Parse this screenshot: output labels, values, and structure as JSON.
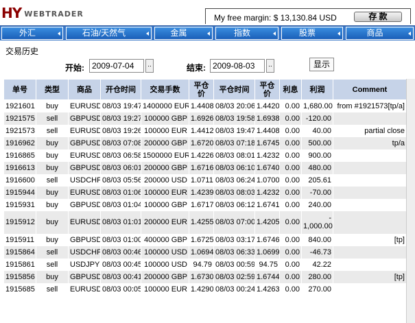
{
  "app": {
    "logo_hy": "HY",
    "logo_sub": "WEBTRADER",
    "margin_label": "My free margin: $ 13,130.84 USD",
    "deposit_label": "存 款"
  },
  "nav": [
    {
      "label": "外汇"
    },
    {
      "label": "石油/天然气"
    },
    {
      "label": "金属"
    },
    {
      "label": "指数"
    },
    {
      "label": "股票"
    },
    {
      "label": "商品"
    }
  ],
  "history": {
    "title": "交易历史",
    "start_label": "开始:",
    "start_value": "2009-07-04",
    "end_label": "结束:",
    "end_value": "2009-08-03",
    "date_btn": "..",
    "show_label": "显示"
  },
  "table": {
    "headers": [
      "单号",
      "类型",
      "商品",
      "开仓时间",
      "交易手数",
      "平仓\n价",
      "平仓时间",
      "平仓\n价",
      "利息",
      "利润",
      "Comment"
    ],
    "rows": [
      [
        "1921601",
        "buy",
        "EURUSD",
        "08/03 19:47",
        "1400000 EUR",
        "1.4408",
        "08/03 20:06",
        "1.4420",
        "0.00",
        "1,680.00",
        "from #1921573[tp/a]"
      ],
      [
        "1921575",
        "sell",
        "GBPUSD",
        "08/03 19:27",
        "100000 GBP",
        "1.6926",
        "08/03 19:58",
        "1.6938",
        "0.00",
        "-120.00",
        ""
      ],
      [
        "1921573",
        "sell",
        "EURUSD",
        "08/03 19:26",
        "100000 EUR",
        "1.4412",
        "08/03 19:47",
        "1.4408",
        "0.00",
        "40.00",
        "partial close"
      ],
      [
        "1916962",
        "buy",
        "GBPUSD",
        "08/03 07:08",
        "200000 GBP",
        "1.6720",
        "08/03 07:18",
        "1.6745",
        "0.00",
        "500.00",
        "tp/a"
      ],
      [
        "1916865",
        "buy",
        "EURUSD",
        "08/03 06:58",
        "1500000 EUR",
        "1.4226",
        "08/03 08:01",
        "1.4232",
        "0.00",
        "900.00",
        ""
      ],
      [
        "1916613",
        "buy",
        "GBPUSD",
        "08/03 06:01",
        "200000 GBP",
        "1.6716",
        "08/03 06:10",
        "1.6740",
        "0.00",
        "480.00",
        ""
      ],
      [
        "1916600",
        "sell",
        "USDCHF",
        "08/03 05:56",
        "200000 USD",
        "1.0711",
        "08/03 06:24",
        "1.0700",
        "0.00",
        "205.61",
        ""
      ],
      [
        "1915944",
        "buy",
        "EURUSD",
        "08/03 01:06",
        "100000 EUR",
        "1.4239",
        "08/03 08:03",
        "1.4232",
        "0.00",
        "-70.00",
        ""
      ],
      [
        "1915931",
        "buy",
        "GBPUSD",
        "08/03 01:04",
        "100000 GBP",
        "1.6717",
        "08/03 06:12",
        "1.6741",
        "0.00",
        "240.00",
        ""
      ],
      [
        "1915912",
        "buy",
        "EURUSD",
        "08/03 01:01",
        "200000 EUR",
        "1.4255",
        "08/03 07:00",
        "1.4205",
        "0.00",
        "-\n1,000.00",
        ""
      ],
      [
        "1915911",
        "buy",
        "GBPUSD",
        "08/03 01:00",
        "400000 GBP",
        "1.6725",
        "08/03 03:17",
        "1.6746",
        "0.00",
        "840.00",
        "[tp]"
      ],
      [
        "1915864",
        "sell",
        "USDCHF",
        "08/03 00:46",
        "100000 USD",
        "1.0694",
        "08/03 06:33",
        "1.0699",
        "0.00",
        "-46.73",
        ""
      ],
      [
        "1915861",
        "sell",
        "USDJPY",
        "08/03 00:45",
        "100000 USD",
        "94.79",
        "08/03 00:59",
        "94.75",
        "0.00",
        "42.22",
        ""
      ],
      [
        "1915856",
        "buy",
        "GBPUSD",
        "08/03 00:41",
        "200000 GBP",
        "1.6730",
        "08/03 02:59",
        "1.6744",
        "0.00",
        "280.00",
        "[tp]"
      ],
      [
        "1915685",
        "sell",
        "EURUSD",
        "08/03 00:05",
        "100000 EUR",
        "1.4290",
        "08/03 00:24",
        "1.4263",
        "0.00",
        "270.00",
        ""
      ]
    ]
  },
  "colors": {
    "nav_bg": "#1a5fb8",
    "header_bg": "#c6d3e8",
    "row_alt": "#eaeaea",
    "logo_red": "#8b0000"
  }
}
